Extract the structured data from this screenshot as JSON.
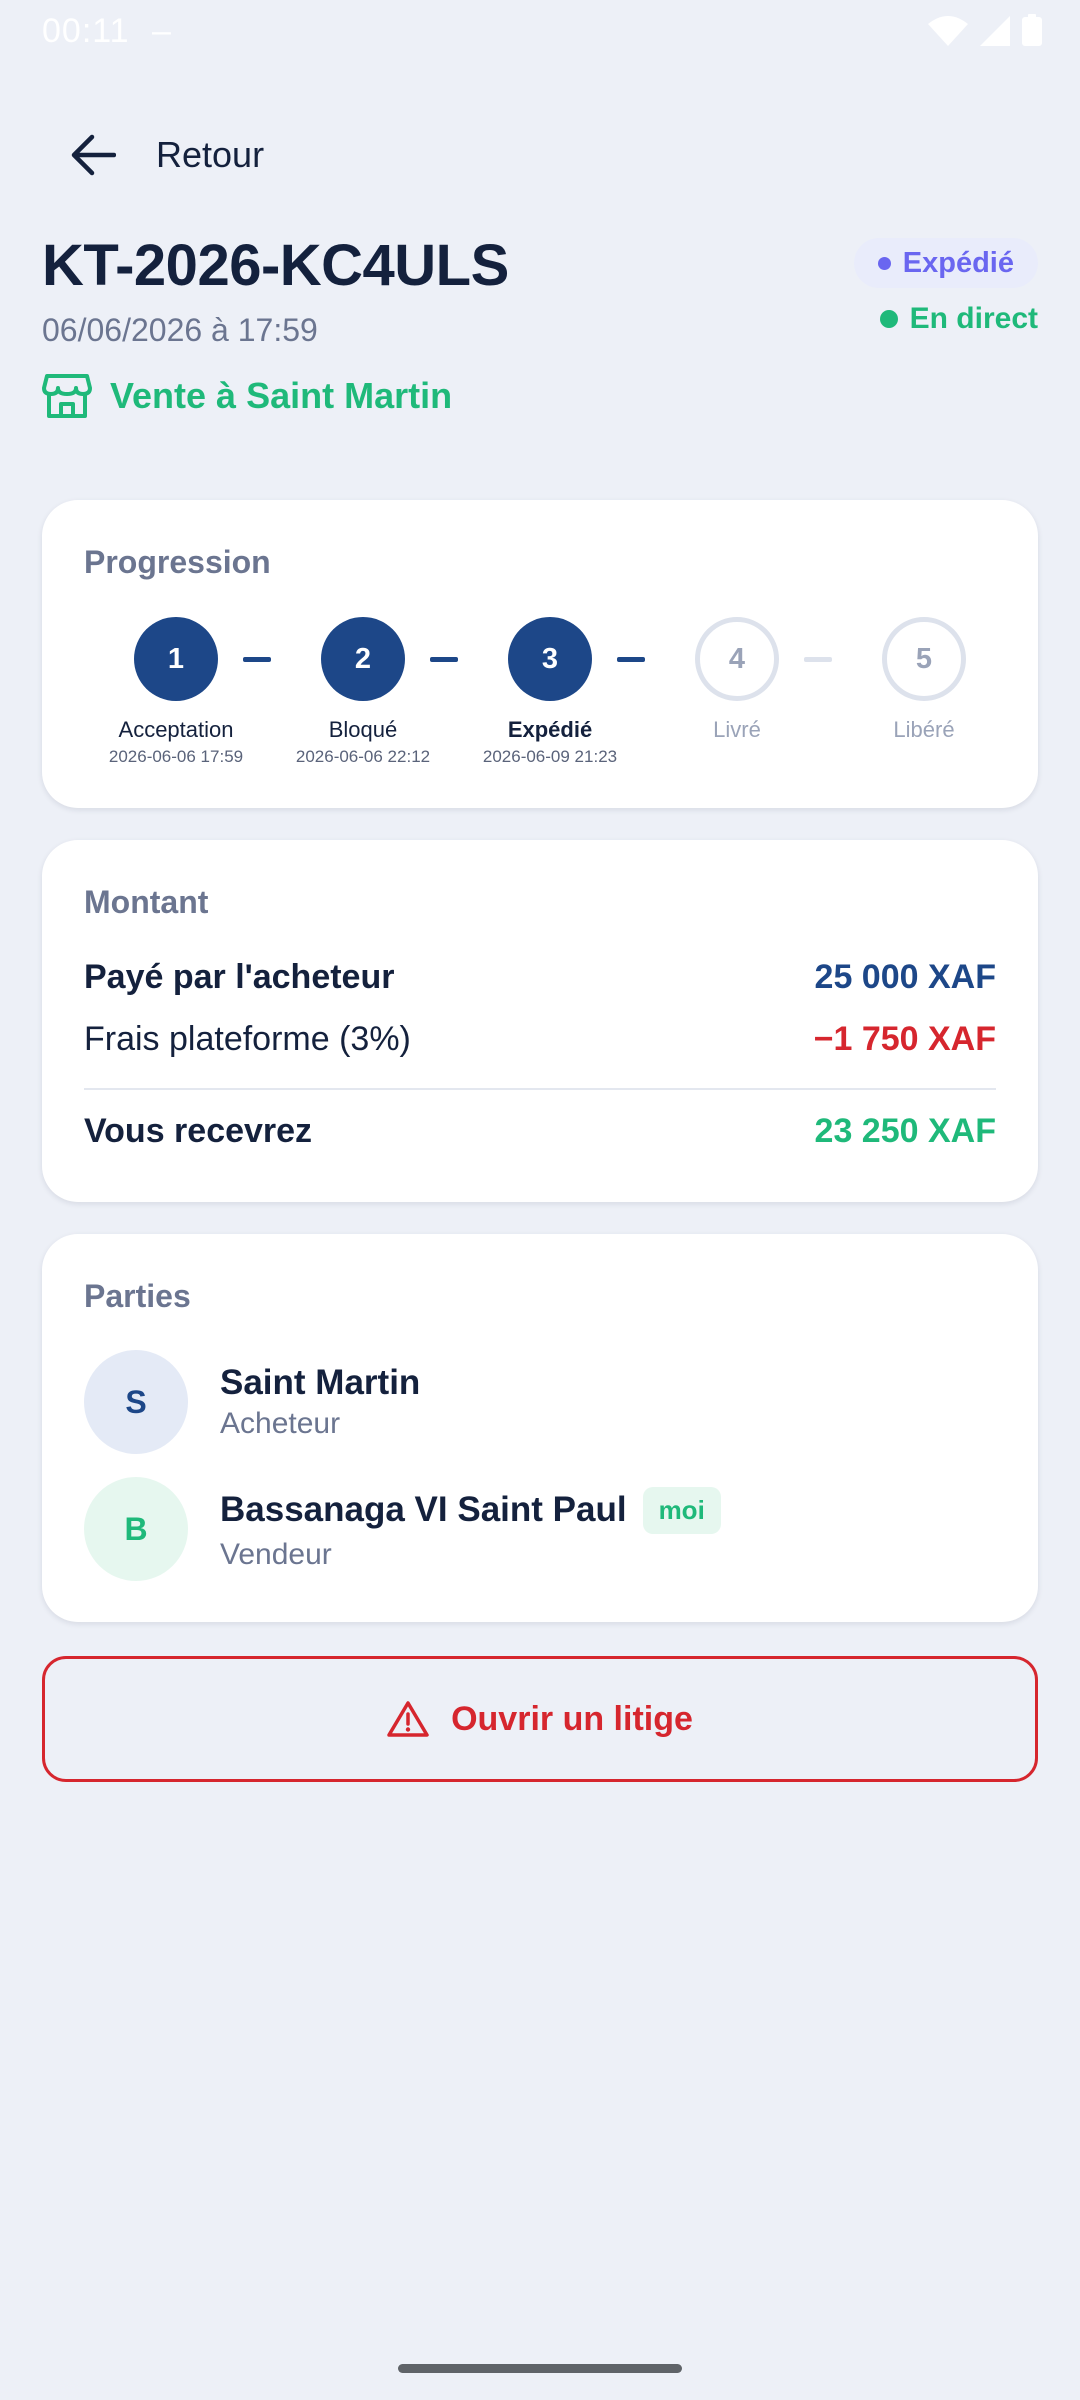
{
  "status_bar": {
    "time": "00:11",
    "indicator": "–"
  },
  "nav": {
    "back_label": "Retour"
  },
  "order": {
    "id": "KT-2026-KC4ULS",
    "date": "06/06/2026 à 17:59",
    "shop_label": "Vente à Saint  Martin",
    "status": "Expédié",
    "live_label": "En direct"
  },
  "progress": {
    "title": "Progression",
    "steps": [
      {
        "number": "1",
        "label": "Acceptation",
        "date": "2026-06-06 17:59",
        "state": "done"
      },
      {
        "number": "2",
        "label": "Bloqué",
        "date": "2026-06-06 22:12",
        "state": "done"
      },
      {
        "number": "3",
        "label": "Expédié",
        "date": "2026-06-09 21:23",
        "state": "current"
      },
      {
        "number": "4",
        "label": "Livré",
        "date": "",
        "state": "todo"
      },
      {
        "number": "5",
        "label": "Libéré",
        "date": "",
        "state": "todo"
      }
    ]
  },
  "amount": {
    "title": "Montant",
    "paid_label": "Payé par l'acheteur",
    "paid_value": "25 000 XAF",
    "fee_label": "Frais plateforme (3%)",
    "fee_value": "−1 750 XAF",
    "receive_label": "Vous recevrez",
    "receive_value": "23 250 XAF"
  },
  "parties": {
    "title": "Parties",
    "buyer": {
      "initial": "S",
      "name": "Saint  Martin",
      "role": "Acheteur"
    },
    "seller": {
      "initial": "B",
      "name": "Bassanaga VI Saint Paul",
      "role": "Vendeur",
      "badge": "moi"
    }
  },
  "dispute": {
    "label": "Ouvrir un litige"
  },
  "colors": {
    "navy": "#1d4788",
    "green": "#1fb97a",
    "red": "#d6262e",
    "indigo": "#6a66f0",
    "background": "#edf0f7"
  },
  "icons": [
    "arrow-left-icon",
    "store-icon",
    "warning-triangle-icon",
    "wifi-icon",
    "cellular-signal-icon",
    "battery-icon"
  ]
}
